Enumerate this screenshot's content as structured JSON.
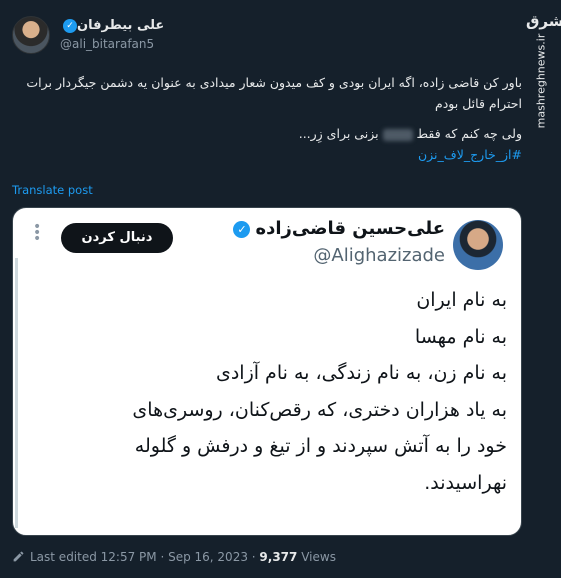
{
  "author": {
    "name": "علی بیطرفان",
    "handle": "@ali_bitarafan5",
    "verified_mark": "✓"
  },
  "tweet": {
    "paragraph1": "باور کن قاضی زاده، اگه ایران بودی و کف میدون شعار میدادی به عنوان یه دشمن جیگردار برات احترام قائل بودم",
    "paragraph2_before": "ولی چه کنم که فقط",
    "paragraph2_after": "بزنی برای زِر...",
    "hashtag": "#از_خارج_لاف_نزن"
  },
  "translate_label": "Translate post",
  "quote": {
    "name": "علی‌حسین قاضی‌زاده",
    "handle": "@Alighazizade",
    "verified_mark": "✓",
    "follow_label": "دنبال کردن",
    "lines": [
      "به نام ایران",
      "به نام مهسا",
      "به نام زن، به نام زندگی، به نام آزادی",
      "به یاد هزاران دختری، که رقص‌کنان، روسری‌های",
      "خود را به آتش سپردند و از تیغ و درفش و گلوله",
      "نهراسیدند."
    ]
  },
  "meta": {
    "edited": "Last edited 12:57 PM · Sep 16, 2023 ·",
    "views_count": "9,377",
    "views_label": "Views"
  },
  "watermark": {
    "logo": "مشرق",
    "site": "mashreghnews.ir"
  },
  "colors": {
    "background": "#15202b",
    "accent": "#1d9bf0",
    "card": "#ffffff",
    "muted": "#8b98a5"
  },
  "icons": [
    "verified-badge-icon",
    "more-options-icon",
    "edit-pencil-icon"
  ]
}
